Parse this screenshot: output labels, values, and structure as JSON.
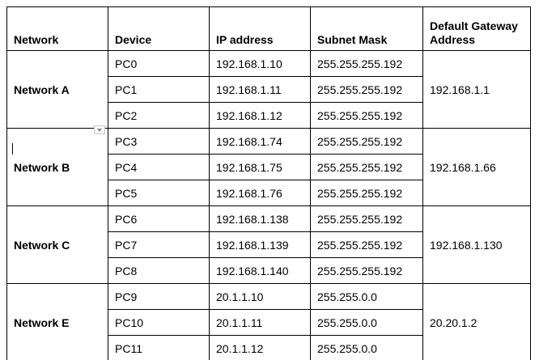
{
  "table": {
    "headers": {
      "network": "Network",
      "device": "Device",
      "ip": "IP address",
      "mask": "Subnet Mask",
      "gateway": "Default Gateway Address"
    },
    "groups": [
      {
        "network": "Network A",
        "gateway": "192.168.1.1",
        "rows": [
          {
            "device": "PC0",
            "ip": "192.168.1.10",
            "mask": "255.255.255.192"
          },
          {
            "device": "PC1",
            "ip": "192.168.1.11",
            "mask": "255.255.255.192"
          },
          {
            "device": "PC2",
            "ip": "192.168.1.12",
            "mask": "255.255.255.192"
          }
        ]
      },
      {
        "network": "Network B",
        "gateway": "192.168.1.66",
        "rows": [
          {
            "device": "PC3",
            "ip": "192.168.1.74",
            "mask": "255.255.255.192"
          },
          {
            "device": "PC4",
            "ip": "192.168.1.75",
            "mask": "255.255.255.192"
          },
          {
            "device": "PC5",
            "ip": "192.168.1.76",
            "mask": "255.255.255.192"
          }
        ]
      },
      {
        "network": "Network C",
        "gateway": "192.168.1.130",
        "rows": [
          {
            "device": "PC6",
            "ip": "192.168.1.138",
            "mask": "255.255.255.192"
          },
          {
            "device": "PC7",
            "ip": "192.168.1.139",
            "mask": "255.255.255.192"
          },
          {
            "device": "PC8",
            "ip": "192.168.1.140",
            "mask": "255.255.255.192"
          }
        ]
      },
      {
        "network": "Network E",
        "gateway": "20.20.1.2",
        "rows": [
          {
            "device": "PC9",
            "ip": "20.1.1.10",
            "mask": "255.255.0.0"
          },
          {
            "device": "PC10",
            "ip": "20.1.1.11",
            "mask": "255.255.0.0"
          },
          {
            "device": "PC11",
            "ip": "20.1.1.12",
            "mask": "255.255.0.0"
          }
        ]
      }
    ]
  },
  "icons": {
    "cell_dropdown": "chevron-down-icon",
    "text_cursor": "text-cursor-icon"
  },
  "colors": {
    "border": "#000000",
    "text": "#000000",
    "background": "#ffffff"
  }
}
